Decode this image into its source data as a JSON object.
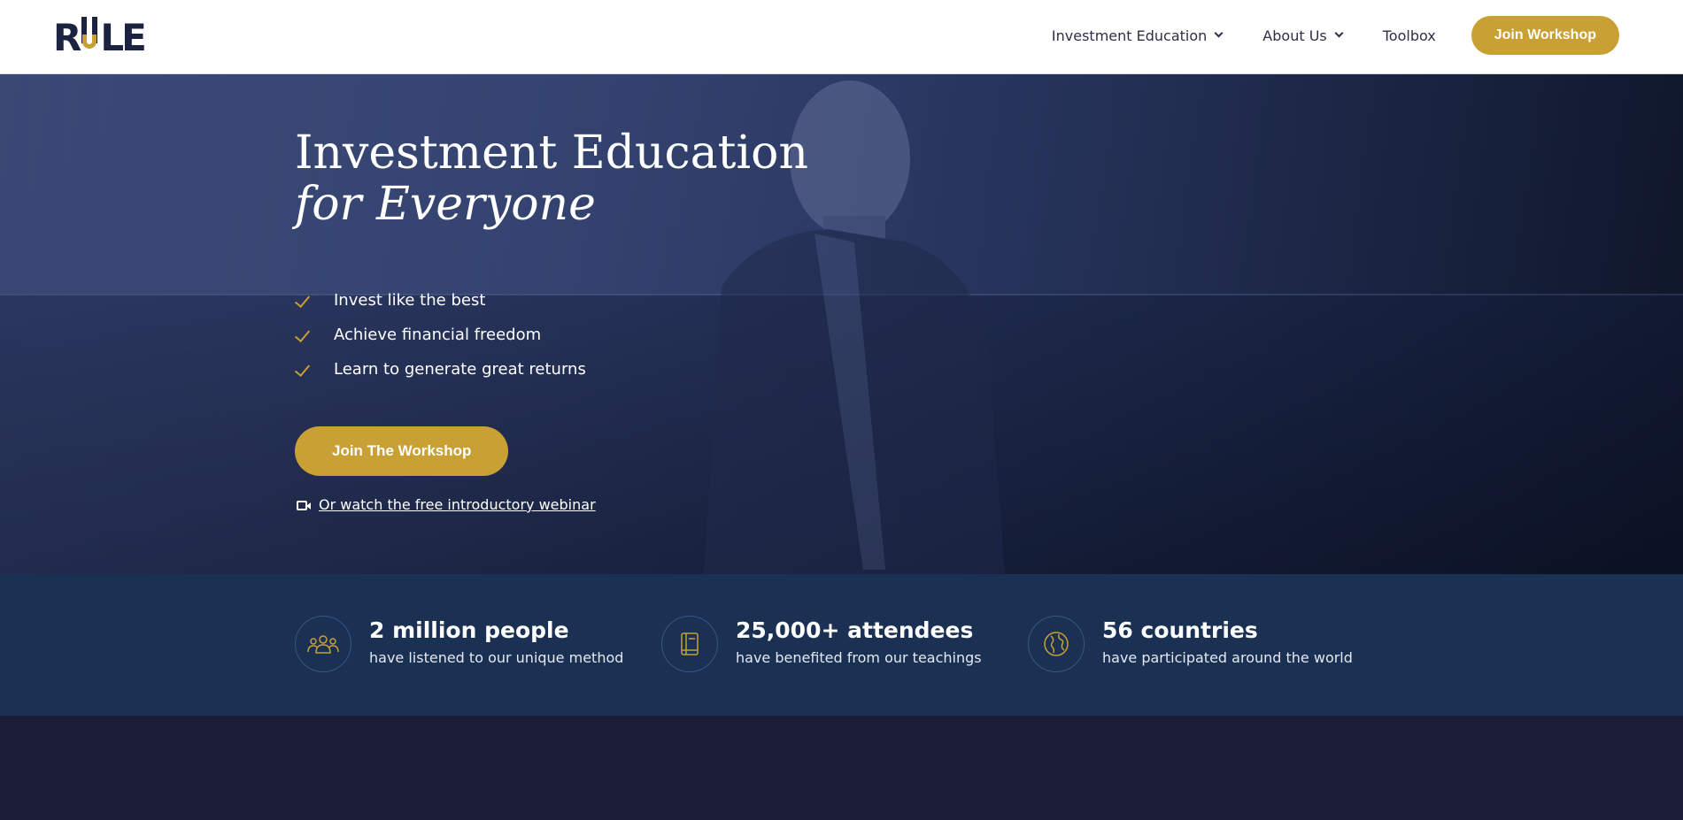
{
  "header": {
    "logo_alt": "RULE",
    "nav": {
      "investment_education": "Investment Education",
      "about_us": "About Us",
      "toolbox": "Toolbox",
      "join_workshop": "Join Workshop"
    }
  },
  "hero": {
    "title_line1": "Investment Education",
    "title_line2": "for Everyone",
    "checklist": [
      "Invest like the best",
      "Achieve financial freedom",
      "Learn to generate great returns"
    ],
    "cta_label": "Join The Workshop",
    "webinar_link": "Or watch the free introductory webinar"
  },
  "stats": [
    {
      "icon": "people-icon",
      "title": "2 million people",
      "subtitle": "have listened to our unique method"
    },
    {
      "icon": "book-icon",
      "title": "25,000+ attendees",
      "subtitle": "have benefited from our teachings"
    },
    {
      "icon": "globe-icon",
      "title": "56 countries",
      "subtitle": "have participated around the world"
    }
  ],
  "colors": {
    "accent_gold": "#c9a033",
    "navy_dark": "#1c2340",
    "stats_bg": "#1a3154",
    "page_bg": "#1b1d37"
  }
}
